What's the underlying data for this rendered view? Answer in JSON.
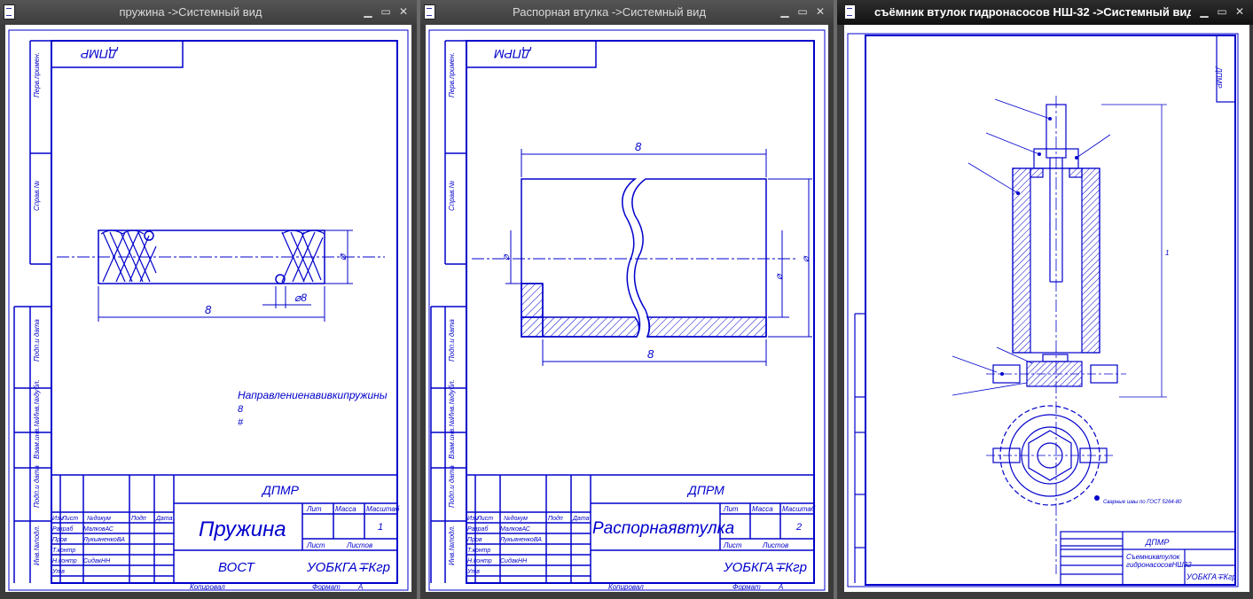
{
  "windows": [
    {
      "title": "пружина ->Системный вид",
      "drawing": {
        "stamp_top": "ДПМР",
        "side_labels": [
          "Перв.примен.",
          "Справ.№",
          "Подп.и дата",
          "Инв.№дубл.",
          "Взам.инв.№",
          "Подп.и дата",
          "Инв.№подл."
        ],
        "dim_length": "8",
        "dim_diameter": "⌀",
        "dim_wire": "⌀8",
        "note_title": "Направлениенавивкипружины",
        "note_line1": "8",
        "note_line2": "#",
        "tb_code": "ДПМР",
        "tb_name": "Пружина",
        "tb_material": "ВОСТ",
        "tb_org": "УОБКГА∓Кгр",
        "tb_sheet_total": "1",
        "tb_lit": "Лит",
        "tb_mass": "Масса",
        "tb_scale": "Масштаб",
        "tb_sheet": "Лист",
        "tb_sheets": "Листов",
        "tb_rows": [
          {
            "role": "Изм",
            "name": "Лист",
            "doc": "№докум",
            "sign": "Подп",
            "date": "Дата"
          },
          {
            "role": "Разраб",
            "name": "МалковАС"
          },
          {
            "role": "Пров",
            "name": "ЛукьяненкоВА"
          },
          {
            "role": "Т.контр",
            "name": ""
          },
          {
            "role": "Н.контр",
            "name": "СидакНН"
          },
          {
            "role": "Утв",
            "name": ""
          }
        ],
        "copied": "Копировал",
        "format": "Формат",
        "format_value": "А"
      }
    },
    {
      "title": "Распорная втулка ->Системный вид",
      "drawing": {
        "stamp_top": "ДПРМ",
        "side_labels": [
          "Перв.примен.",
          "Справ.№",
          "Подп.и дата",
          "Инв.№дубл.",
          "Взам.инв.№",
          "Подп.и дата",
          "Инв.№подл."
        ],
        "dim_top": "8",
        "dim_bottom": "8",
        "dim_left": "⌀",
        "dim_right1": "⌀",
        "dim_right2": "⌀",
        "tb_code": "ДПРМ",
        "tb_name": "Распорнаявтулка",
        "tb_material": "",
        "tb_org": "УОБКГА∓Кгр",
        "tb_sheet_total": "2",
        "tb_lit": "Лит",
        "tb_mass": "Масса",
        "tb_scale": "Масштаб",
        "tb_sheet": "Лист",
        "tb_sheets": "Листов",
        "tb_rows": [
          {
            "role": "Изм",
            "name": "Лист",
            "doc": "№докум",
            "sign": "Подп",
            "date": "Дата"
          },
          {
            "role": "Разраб",
            "name": "МалковАС"
          },
          {
            "role": "Пров",
            "name": "ЛукьяненкоВА"
          },
          {
            "role": "Т.контр",
            "name": ""
          },
          {
            "role": "Н.контр",
            "name": "СидакНН"
          },
          {
            "role": "Утв",
            "name": ""
          }
        ],
        "copied": "Копировал",
        "format": "Формат",
        "format_value": "А"
      }
    },
    {
      "title": "съёмник втулок гидронасосов НШ-32  ->Системный вид",
      "drawing": {
        "stamp_top": "ДПМР",
        "tb_code": "ДПМР",
        "tb_name1": "Съемниквтулок",
        "tb_name2": "гидронасосовНШ32",
        "tb_org": "УОБКГА∓Кгр",
        "note": "Сварные швы по ГОСТ 5264-80",
        "dim_height": "1"
      }
    }
  ],
  "colors": {
    "line": "#0000cc",
    "frame": "#0000cc",
    "titlebar_active": "#111111"
  }
}
